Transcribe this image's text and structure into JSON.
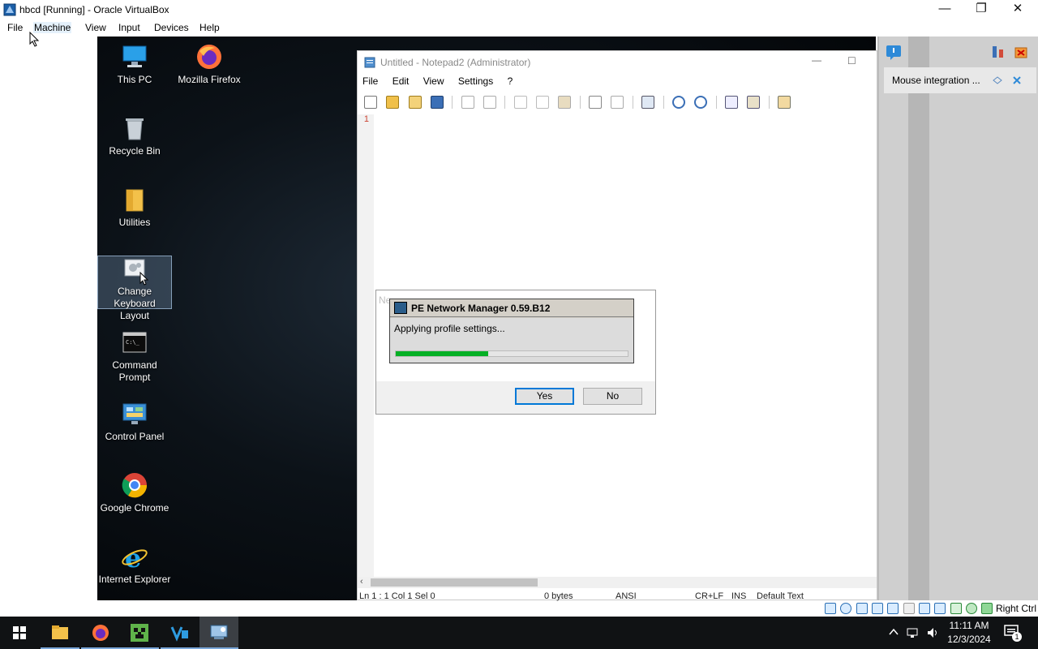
{
  "host": {
    "window_title": "hbcd [Running] - Oracle VirtualBox",
    "menu": [
      "File",
      "Machine",
      "View",
      "Input",
      "Devices",
      "Help"
    ],
    "status_right": "Right Ctrl"
  },
  "desktop_icons": [
    {
      "label": "This PC",
      "icon": "this-pc-icon"
    },
    {
      "label": "Mozilla Firefox",
      "icon": "firefox-icon"
    },
    {
      "label": "Recycle Bin",
      "icon": "recycle-bin-icon"
    },
    {
      "label": "Utilities",
      "icon": "folder-icon"
    },
    {
      "label": "Change Keyboard Layout",
      "icon": "keyboard-settings-icon"
    },
    {
      "label": "Command Prompt",
      "icon": "command-prompt-icon"
    },
    {
      "label": "Control Panel",
      "icon": "control-panel-icon"
    },
    {
      "label": "Google Chrome",
      "icon": "chrome-icon"
    },
    {
      "label": "Internet Explorer",
      "icon": "internet-explorer-icon"
    }
  ],
  "notepad": {
    "title": "Untitled - Notepad2 (Administrator)",
    "menu": [
      "File",
      "Edit",
      "View",
      "Settings",
      "?"
    ],
    "line_number": "1",
    "status": {
      "position": "Ln 1 : 1   Col 1   Sel 0",
      "size": "0 bytes",
      "encoding": "ANSI",
      "line_ending": "CR+LF",
      "mode": "INS",
      "scheme": "Default Text"
    }
  },
  "message_box": {
    "ghost_title": "Ne...",
    "yes_label": "Yes",
    "no_label": "No"
  },
  "progress_dialog": {
    "title": "PE Network Manager 0.59.B12",
    "message": "Applying profile settings...",
    "progress_fraction": 0.4
  },
  "vbox_panel": {
    "notification": "Mouse integration ..."
  },
  "taskbar": {
    "time": "11:11 AM",
    "date": "12/3/2024",
    "notifications_count": "1"
  },
  "colors": {
    "progress_green": "#06b025",
    "taskbar": "#101214",
    "accent": "#0078d7"
  }
}
